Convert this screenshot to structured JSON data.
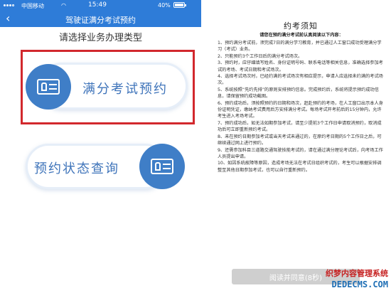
{
  "status_bar": {
    "carrier": "中国移动",
    "time": "15:49",
    "battery": "40%"
  },
  "nav": {
    "back_icon": "‹",
    "title": "驾驶证满分考试预约"
  },
  "main": {
    "section_title": "请选择业务办理类型",
    "buttons": [
      {
        "label": "满分考试预约",
        "icon": "id-card-icon"
      },
      {
        "label": "预约状态查询",
        "icon": "id-card-icon"
      }
    ],
    "colors": {
      "accent": "#2e7cd8",
      "highlight": "#d2282d",
      "button_text": "#3f74ba"
    }
  },
  "notice": {
    "title": "约考须知",
    "subtitle": "请您在预约满分考试前认真阅读以下内容：",
    "items": [
      "1、预约满分考试前，须完成7日的满分学习教育，并已通过人工窗口成功受理满分学习（考试）业务。",
      "2、只能预约3个工作日后的满分考试场次。",
      "3、预约时，应仔细填写姓名、身份证明号码、联系电话等相关信息，准确选择参加考试的考场、考试日期和考试场次。",
      "4、选择考试场次时，已经约满的考试场次有相应提示，申请人应选择未约满的考试场次。",
      "5、系统按照“先约先排”的原则安排预约信息。完成预约后，系统将提示预约成功信息，请保留预约成功截图。",
      "6、预约成功后，须按照预约的日期和场次，赶赴预约的考场，在人工窗口出示本人身份证明凭证，缴纳考试费用后方安排满分考试。每场考试开考前后的15分钟内，允许考生进入考场考试。",
      "7、预约成功后，如无法如期参加考试，请至少提前3个工作日申请取消预约，取消成功后可立即重新预约考试。",
      "8、未在预约日期参加考试或当天考试未通过的，在原约考日期的5个工作日之后，可继续通过网上进行预约。",
      "9、还需参加科目三道路交通驾驶技能考试的，请在通过满分理论考试后，向考场工作人员提出申请。",
      "10、如因系统故障等原因，造成考场无法在考试日组织考试的，考生可以根据安排调整至其他日期参加考试，也可以自行重新预约。"
    ],
    "agree_button": "阅读并同意(8秒)"
  },
  "watermark": {
    "top": "织梦内容管理系统",
    "bottom": "DEDECMS.COM"
  }
}
